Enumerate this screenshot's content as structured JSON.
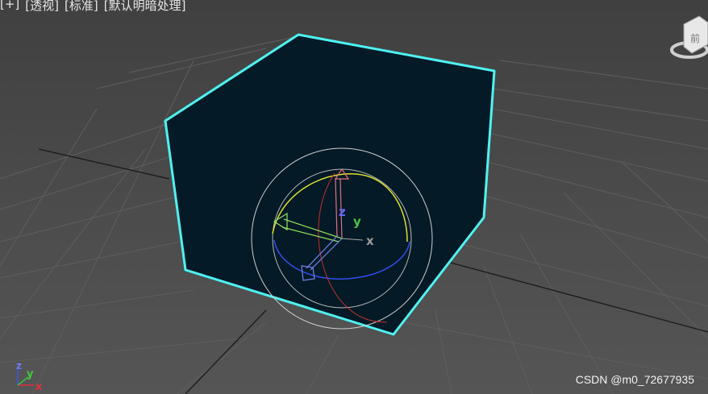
{
  "viewport_menu": {
    "plus": "[+]",
    "view": "[透视]",
    "shading_mode": "[标准]",
    "lighting": "[默认明暗处理]"
  },
  "viewcube": {
    "face_label": "前"
  },
  "gizmo": {
    "x_label": "x",
    "y_label": "y",
    "z_label": "z"
  },
  "axis_tripod": {
    "x_label": "x",
    "y_label": "y",
    "z_label": "z"
  },
  "watermark": "CSDN @m0_72677935",
  "colors": {
    "background": "#4b4b4b",
    "grid": "#5e5e5e",
    "grid_dark": "#1a1a1a",
    "cube_fill": "#041a26",
    "selection": "#4ef2f2",
    "axis_x": "#e0303a",
    "axis_y": "#36c436",
    "axis_z": "#3a57e8",
    "sphere": "#cccccc",
    "ring_yellow": "#dede30"
  }
}
